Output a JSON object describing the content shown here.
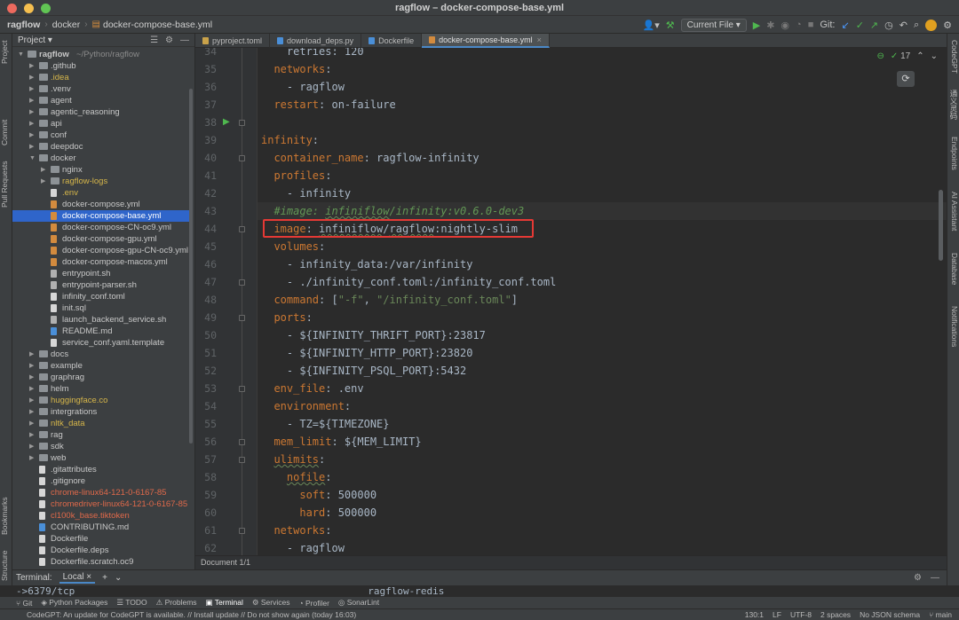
{
  "window": {
    "title": "ragflow – docker-compose-base.yml"
  },
  "breadcrumb": {
    "project": "ragflow",
    "folder": "docker",
    "file": "docker-compose-base.yml"
  },
  "toolbar": {
    "run_config": "Current File",
    "git_label": "Git:"
  },
  "left_strip": [
    "Project",
    "Commit",
    "Pull Requests",
    "Bookmarks",
    "Structure"
  ],
  "right_strip": [
    "CodeGPT",
    "通义灵码",
    "Endpoints",
    "AI Assistant",
    "Database",
    "Notifications"
  ],
  "project_panel": {
    "title": "Project",
    "tree": [
      {
        "label": "ragflow",
        "suffix": "~/Python/ragflow",
        "depth": 0,
        "kind": "folder",
        "expanded": true
      },
      {
        "label": ".github",
        "depth": 1,
        "kind": "folder"
      },
      {
        "label": ".idea",
        "depth": 1,
        "kind": "folder",
        "color": "yellow"
      },
      {
        "label": ".venv",
        "depth": 1,
        "kind": "folder"
      },
      {
        "label": "agent",
        "depth": 1,
        "kind": "folder"
      },
      {
        "label": "agentic_reasoning",
        "depth": 1,
        "kind": "folder"
      },
      {
        "label": "api",
        "depth": 1,
        "kind": "folder"
      },
      {
        "label": "conf",
        "depth": 1,
        "kind": "folder"
      },
      {
        "label": "deepdoc",
        "depth": 1,
        "kind": "folder"
      },
      {
        "label": "docker",
        "depth": 1,
        "kind": "folder",
        "expanded": true
      },
      {
        "label": "nginx",
        "depth": 2,
        "kind": "folder"
      },
      {
        "label": "ragflow-logs",
        "depth": 2,
        "kind": "folder",
        "color": "yellow"
      },
      {
        "label": ".env",
        "depth": 2,
        "kind": "file",
        "color": "yellow"
      },
      {
        "label": "docker-compose.yml",
        "depth": 2,
        "kind": "yml"
      },
      {
        "label": "docker-compose-base.yml",
        "depth": 2,
        "kind": "yml",
        "selected": true
      },
      {
        "label": "docker-compose-CN-oc9.yml",
        "depth": 2,
        "kind": "yml"
      },
      {
        "label": "docker-compose-gpu.yml",
        "depth": 2,
        "kind": "yml"
      },
      {
        "label": "docker-compose-gpu-CN-oc9.yml",
        "depth": 2,
        "kind": "yml"
      },
      {
        "label": "docker-compose-macos.yml",
        "depth": 2,
        "kind": "yml"
      },
      {
        "label": "entrypoint.sh",
        "depth": 2,
        "kind": "sh"
      },
      {
        "label": "entrypoint-parser.sh",
        "depth": 2,
        "kind": "sh"
      },
      {
        "label": "infinity_conf.toml",
        "depth": 2,
        "kind": "file"
      },
      {
        "label": "init.sql",
        "depth": 2,
        "kind": "file"
      },
      {
        "label": "launch_backend_service.sh",
        "depth": 2,
        "kind": "sh"
      },
      {
        "label": "README.md",
        "depth": 2,
        "kind": "md"
      },
      {
        "label": "service_conf.yaml.template",
        "depth": 2,
        "kind": "file"
      },
      {
        "label": "docs",
        "depth": 1,
        "kind": "folder"
      },
      {
        "label": "example",
        "depth": 1,
        "kind": "folder"
      },
      {
        "label": "graphrag",
        "depth": 1,
        "kind": "folder"
      },
      {
        "label": "helm",
        "depth": 1,
        "kind": "folder"
      },
      {
        "label": "huggingface.co",
        "depth": 1,
        "kind": "folder",
        "color": "yellow"
      },
      {
        "label": "intergrations",
        "depth": 1,
        "kind": "folder"
      },
      {
        "label": "nltk_data",
        "depth": 1,
        "kind": "folder",
        "color": "yellow"
      },
      {
        "label": "rag",
        "depth": 1,
        "kind": "folder"
      },
      {
        "label": "sdk",
        "depth": 1,
        "kind": "folder"
      },
      {
        "label": "web",
        "depth": 1,
        "kind": "folder"
      },
      {
        "label": ".gitattributes",
        "depth": 1,
        "kind": "file",
        "leaf": true
      },
      {
        "label": ".gitignore",
        "depth": 1,
        "kind": "file",
        "leaf": true
      },
      {
        "label": "chrome-linux64-121-0-6167-85",
        "depth": 1,
        "kind": "file",
        "color": "red",
        "leaf": true
      },
      {
        "label": "chromedriver-linux64-121-0-6167-85",
        "depth": 1,
        "kind": "file",
        "color": "red",
        "leaf": true
      },
      {
        "label": "cl100k_base.tiktoken",
        "depth": 1,
        "kind": "file",
        "color": "red",
        "leaf": true
      },
      {
        "label": "CONTRIBUTING.md",
        "depth": 1,
        "kind": "md",
        "leaf": true
      },
      {
        "label": "Dockerfile",
        "depth": 1,
        "kind": "file",
        "leaf": true
      },
      {
        "label": "Dockerfile.deps",
        "depth": 1,
        "kind": "file",
        "leaf": true
      },
      {
        "label": "Dockerfile.scratch.oc9",
        "depth": 1,
        "kind": "file",
        "leaf": true
      }
    ]
  },
  "editor_tabs": [
    {
      "label": "pyproject.toml",
      "color": "#c9a24a"
    },
    {
      "label": "download_deps.py",
      "color": "#4a8fd8"
    },
    {
      "label": "Dockerfile",
      "color": "#4a8fd8"
    },
    {
      "label": "docker-compose-base.yml",
      "color": "#d38b3e",
      "active": true
    }
  ],
  "editor": {
    "inspection_count": "17",
    "first_line": 34,
    "lines": [
      [
        {
          "t": "    retries: 120",
          "c": ""
        }
      ],
      [
        {
          "t": "  networks",
          "c": "k"
        },
        {
          "t": ":",
          "c": ""
        }
      ],
      [
        {
          "t": "    - ragflow",
          "c": ""
        }
      ],
      [
        {
          "t": "  restart",
          "c": "k"
        },
        {
          "t": ": on-failure",
          "c": ""
        }
      ],
      [
        {
          "t": "",
          "c": ""
        }
      ],
      [
        {
          "t": "infinity",
          "c": "k"
        },
        {
          "t": ":",
          "c": ""
        }
      ],
      [
        {
          "t": "  container_name",
          "c": "k"
        },
        {
          "t": ": ragflow-infinity",
          "c": ""
        }
      ],
      [
        {
          "t": "  profiles",
          "c": "k"
        },
        {
          "t": ":",
          "c": ""
        }
      ],
      [
        {
          "t": "    - infinity",
          "c": ""
        }
      ],
      [
        {
          "t": "  #image: ",
          "c": "cm"
        },
        {
          "t": "infiniflow",
          "c": "cm sq"
        },
        {
          "t": "/infinity:v0.6.0-dev3",
          "c": "cm"
        }
      ],
      [
        {
          "t": "  image",
          "c": "k"
        },
        {
          "t": ": ",
          "c": ""
        },
        {
          "t": "infiniflow",
          "c": "sq"
        },
        {
          "t": "/",
          "c": ""
        },
        {
          "t": "ragflow",
          "c": "sq"
        },
        {
          "t": ":nightly-slim",
          "c": ""
        }
      ],
      [
        {
          "t": "  volumes",
          "c": "k"
        },
        {
          "t": ":",
          "c": ""
        }
      ],
      [
        {
          "t": "    - infinity_data:/var/infinity",
          "c": ""
        }
      ],
      [
        {
          "t": "    - ./infinity_conf.toml:/infinity_conf.toml",
          "c": ""
        }
      ],
      [
        {
          "t": "  command",
          "c": "k"
        },
        {
          "t": ": [",
          "c": ""
        },
        {
          "t": "\"-f\"",
          "c": "s"
        },
        {
          "t": ", ",
          "c": ""
        },
        {
          "t": "\"/infinity_conf.toml\"",
          "c": "s"
        },
        {
          "t": "]",
          "c": ""
        }
      ],
      [
        {
          "t": "  ports",
          "c": "k"
        },
        {
          "t": ":",
          "c": ""
        }
      ],
      [
        {
          "t": "    - ${INFINITY_THRIFT_PORT}:23817",
          "c": ""
        }
      ],
      [
        {
          "t": "    - ${INFINITY_HTTP_PORT}:23820",
          "c": ""
        }
      ],
      [
        {
          "t": "    - ${INFINITY_PSQL_PORT}:5432",
          "c": ""
        }
      ],
      [
        {
          "t": "  env_file",
          "c": "k"
        },
        {
          "t": ": .env",
          "c": ""
        }
      ],
      [
        {
          "t": "  environment",
          "c": "k"
        },
        {
          "t": ":",
          "c": ""
        }
      ],
      [
        {
          "t": "    - TZ=${TIMEZONE}",
          "c": ""
        }
      ],
      [
        {
          "t": "  mem_limit",
          "c": "k"
        },
        {
          "t": ": ${MEM_LIMIT}",
          "c": ""
        }
      ],
      [
        {
          "t": "  ",
          "c": ""
        },
        {
          "t": "ulimits",
          "c": "k sq"
        },
        {
          "t": ":",
          "c": ""
        }
      ],
      [
        {
          "t": "    ",
          "c": ""
        },
        {
          "t": "nofile",
          "c": "k sq"
        },
        {
          "t": ":",
          "c": ""
        }
      ],
      [
        {
          "t": "      soft",
          "c": "k"
        },
        {
          "t": ": 500000",
          "c": ""
        }
      ],
      [
        {
          "t": "      hard",
          "c": "k"
        },
        {
          "t": ": 500000",
          "c": ""
        }
      ],
      [
        {
          "t": "  networks",
          "c": "k"
        },
        {
          "t": ":",
          "c": ""
        }
      ],
      [
        {
          "t": "    - ragflow",
          "c": ""
        }
      ]
    ]
  },
  "doc_breadcrumb": "Document 1/1",
  "terminal": {
    "label": "Terminal:",
    "tab": "Local",
    "line_left": "->6379/tcp",
    "line_right": "ragflow-redis"
  },
  "tool_windows": [
    "Git",
    "Python Packages",
    "TODO",
    "Problems",
    "Terminal",
    "Services",
    "Profiler",
    "SonarLint"
  ],
  "status": {
    "message": "CodeGPT: An update for CodeGPT is available. // Install update // Do not show again (today 16:03)",
    "position": "130:1",
    "line_sep": "LF",
    "encoding": "UTF-8",
    "indent": "2 spaces",
    "schema": "No JSON schema",
    "branch": "main"
  },
  "colors": {
    "selection": "#2f65ca",
    "annotation_red": "#e53935",
    "keyword": "#cc7832",
    "string": "#6a8759"
  }
}
